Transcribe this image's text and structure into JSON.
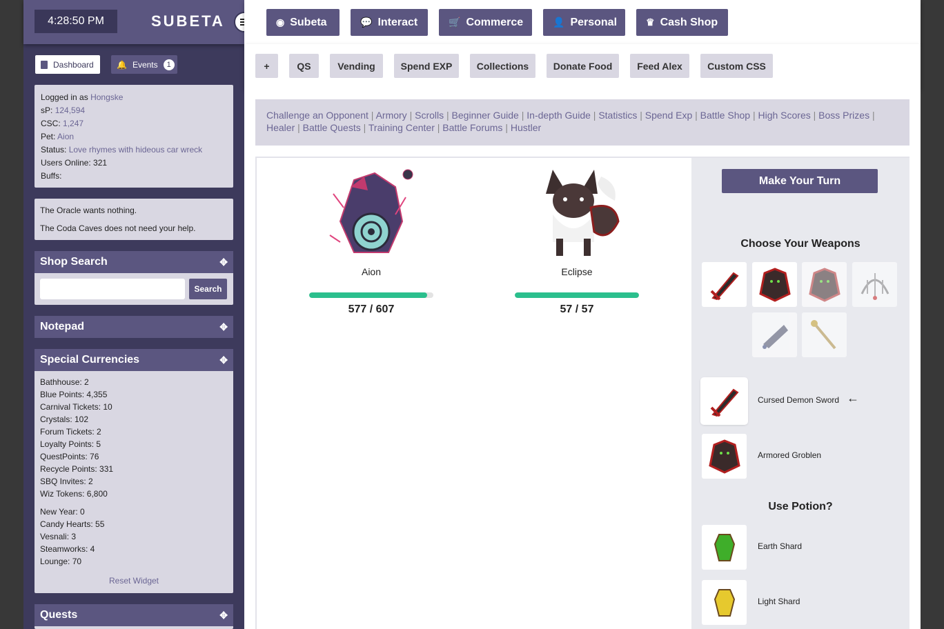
{
  "header": {
    "clock": "4:28:50 PM",
    "logo": "SUBETA",
    "nav": [
      {
        "label": "Subeta",
        "icon": "compass-icon"
      },
      {
        "label": "Interact",
        "icon": "chat-icon"
      },
      {
        "label": "Commerce",
        "icon": "cart-icon"
      },
      {
        "label": "Personal",
        "icon": "user-icon"
      },
      {
        "label": "Cash Shop",
        "icon": "crown-icon"
      }
    ]
  },
  "quickbar": [
    "+",
    "QS",
    "Vending",
    "Spend EXP",
    "Collections",
    "Donate Food",
    "Feed Alex",
    "Custom CSS"
  ],
  "sidebar": {
    "dashboard_label": "Dashboard",
    "events_label": "Events",
    "events_count": "1",
    "user": {
      "logged_in_label": "Logged in as",
      "username": "Hongske",
      "sp_label": "sP:",
      "sp": "124,594",
      "csc_label": "CSC:",
      "csc": "1,247",
      "pet_label": "Pet:",
      "pet": "Aion",
      "status_label": "Status:",
      "status": "Love rhymes with hideous car wreck",
      "online": "Users Online: 321",
      "buffs": "Buffs:"
    },
    "notices": [
      "The Oracle wants nothing.",
      "The Coda Caves does not need your help."
    ],
    "shop_search": {
      "title": "Shop Search",
      "button": "Search",
      "value": ""
    },
    "notepad": {
      "title": "Notepad"
    },
    "currencies": {
      "title": "Special Currencies",
      "group1": [
        "Bathhouse: 2",
        "Blue Points: 4,355",
        "Carnival Tickets: 10",
        "Crystals: 102",
        "Forum Tickets: 2",
        "Loyalty Points: 5",
        "QuestPoints: 76",
        "Recycle Points: 331",
        "SBQ Invites: 2",
        "Wiz Tokens: 6,800"
      ],
      "group2": [
        "New Year: 0",
        "Candy Hearts: 55",
        "Vesnali: 3",
        "Steamworks: 4",
        "Lounge: 70"
      ],
      "reset": "Reset Widget"
    },
    "quests": {
      "title": "Quests"
    }
  },
  "battle_links": [
    "Challenge an Opponent",
    "Armory",
    "Scrolls",
    "Beginner Guide",
    "In-depth Guide",
    "Statistics",
    "Spend Exp",
    "Battle Shop",
    "High Scores",
    "Boss Prizes",
    "Healer",
    "Battle Quests",
    "Training Center",
    "Battle Forums",
    "Hustler"
  ],
  "battle": {
    "player": {
      "name": "Aion",
      "hp_text": "577 / 607",
      "hp_fraction": 0.95
    },
    "opponent": {
      "name": "Eclipse",
      "hp_text": "57 / 57",
      "hp_fraction": 1.0
    },
    "turn_button": "Make Your Turn",
    "weapons_title": "Choose Your Weapons",
    "weapon_icons": [
      "sword-icon",
      "armored-beast-icon",
      "armored-beast-faded-icon",
      "web-icon",
      "blade-icon",
      "staff-icon"
    ],
    "selected": [
      {
        "name": "Cursed Demon Sword",
        "icon": "sword-icon"
      },
      {
        "name": "Armored Groblen",
        "icon": "armored-beast-icon"
      }
    ],
    "potion_title": "Use Potion?",
    "potions": [
      {
        "name": "Earth Shard",
        "icon": "green-crystal-icon",
        "color": "#3fae2a"
      },
      {
        "name": "Light Shard",
        "icon": "yellow-crystal-icon",
        "color": "#e6c92e"
      }
    ]
  },
  "colors": {
    "accent": "#5b5680",
    "hp": "#2bbf8d",
    "panel": "#d9d7e2"
  }
}
